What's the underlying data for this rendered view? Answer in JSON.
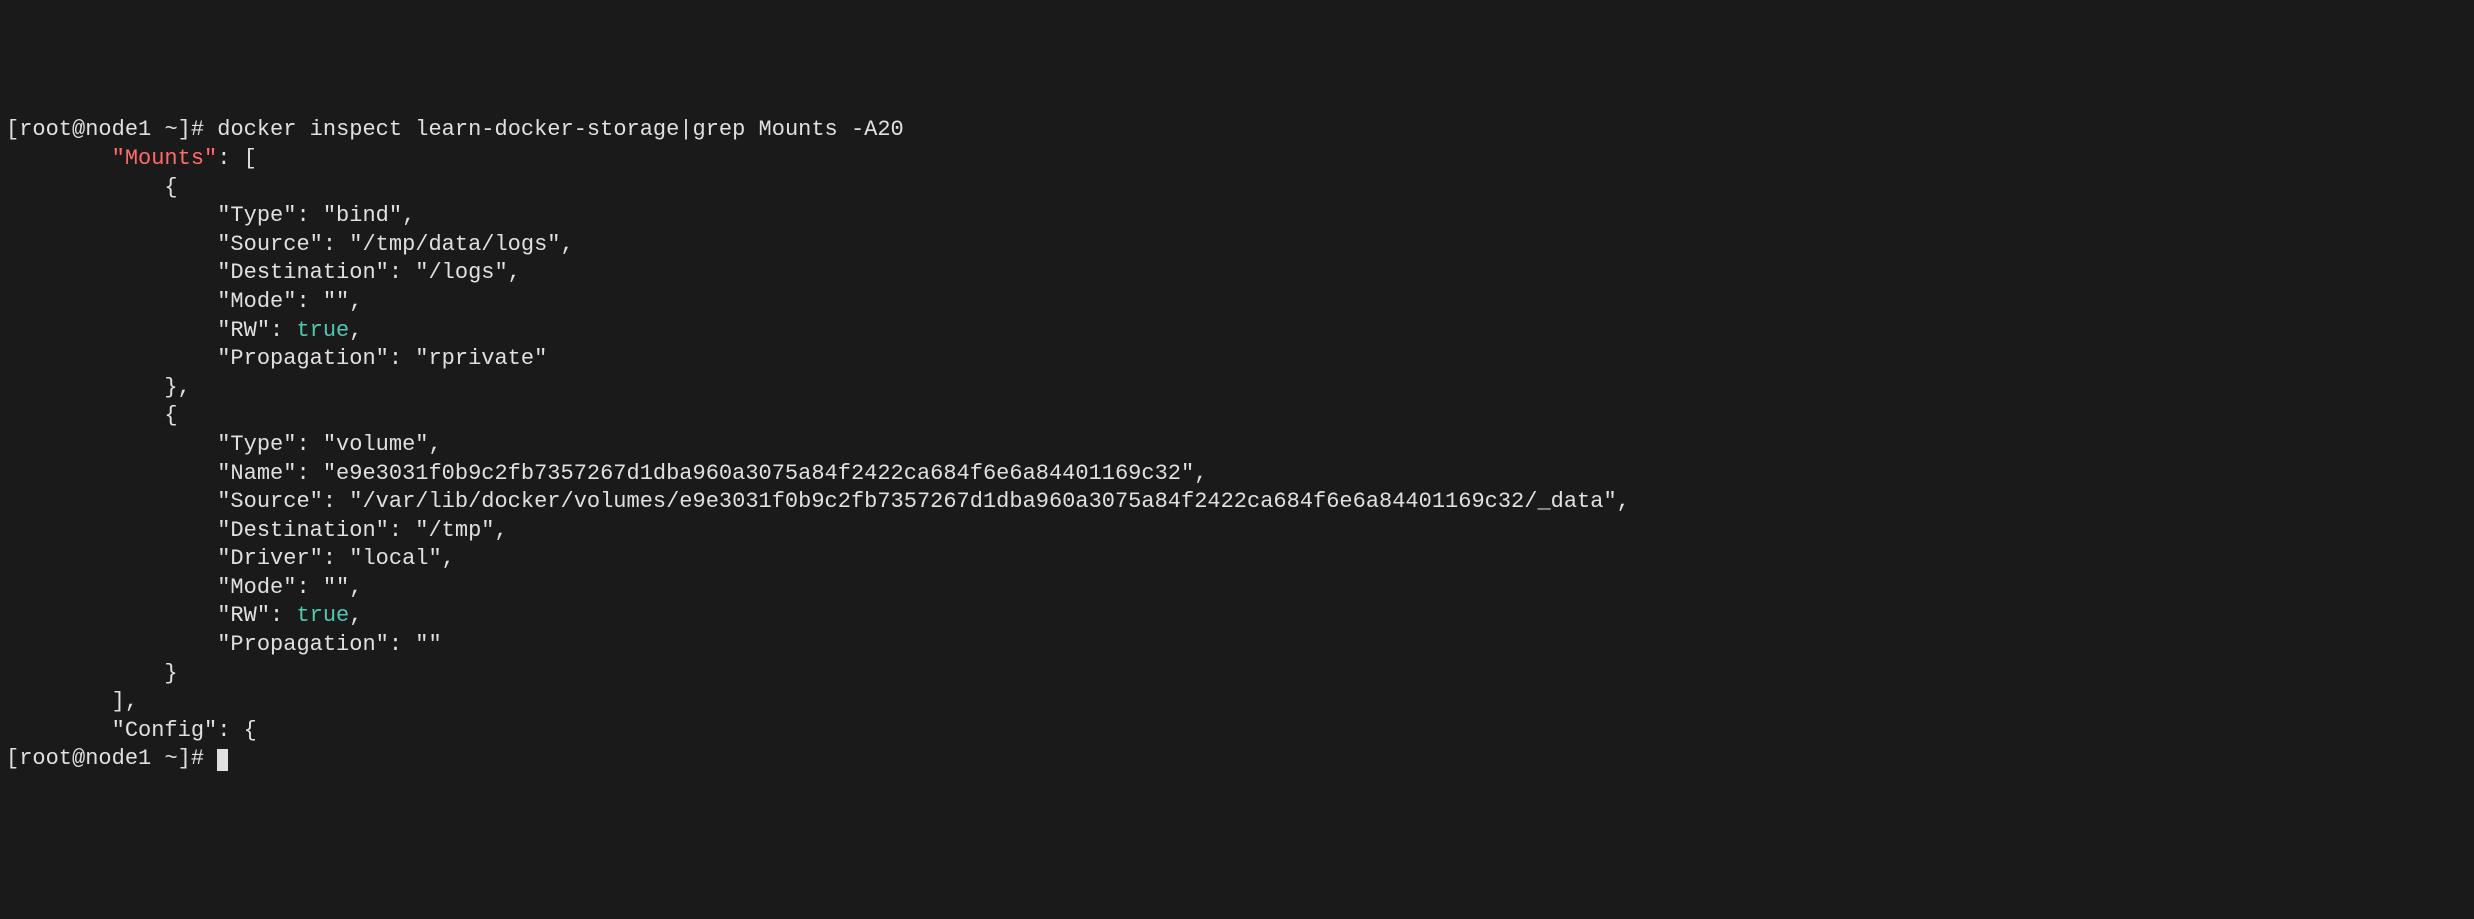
{
  "prompt1": {
    "user": "root",
    "host": "node1",
    "dir": "~",
    "symbol": "#"
  },
  "command": "docker inspect learn-docker-storage|grep Mounts -A20",
  "output": {
    "mounts_key": "\"Mounts\"",
    "mounts_open": ": [",
    "brace_open1": "            {",
    "type1": "                \"Type\": \"bind\",",
    "source1": "                \"Source\": \"/tmp/data/logs\",",
    "dest1": "                \"Destination\": \"/logs\",",
    "mode1": "                \"Mode\": \"\",",
    "rw1_prefix": "                \"RW\": ",
    "rw1_value": "true",
    "rw1_suffix": ",",
    "prop1": "                \"Propagation\": \"rprivate\"",
    "brace_close1": "            },",
    "brace_open2": "            {",
    "type2": "                \"Type\": \"volume\",",
    "name2": "                \"Name\": \"e9e3031f0b9c2fb7357267d1dba960a3075a84f2422ca684f6e6a84401169c32\",",
    "source2": "                \"Source\": \"/var/lib/docker/volumes/e9e3031f0b9c2fb7357267d1dba960a3075a84f2422ca684f6e6a84401169c32/_data\",",
    "dest2": "                \"Destination\": \"/tmp\",",
    "driver2": "                \"Driver\": \"local\",",
    "mode2": "                \"Mode\": \"\",",
    "rw2_prefix": "                \"RW\": ",
    "rw2_value": "true",
    "rw2_suffix": ",",
    "prop2": "                \"Propagation\": \"\"",
    "brace_close2": "            }",
    "array_close": "        ],",
    "config_line": "        \"Config\": {"
  },
  "prompt2": {
    "user": "root",
    "host": "node1",
    "dir": "~",
    "symbol": "#"
  }
}
